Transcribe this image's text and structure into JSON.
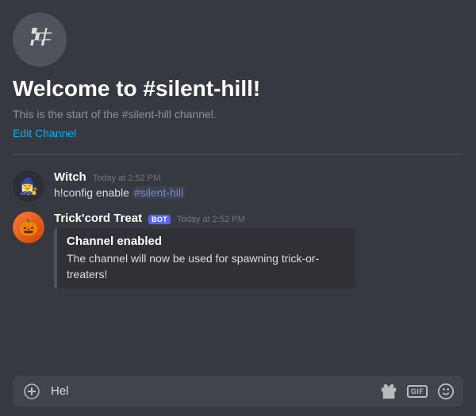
{
  "channel": {
    "icon": "#",
    "title": "Welcome to #silent-hill!",
    "description": "This is the start of the #silent-hill channel.",
    "edit_link": "Edit Channel"
  },
  "messages": [
    {
      "id": "msg1",
      "avatar_emoji": "🧙‍♀️",
      "avatar_type": "witch",
      "username": "Witch",
      "is_bot": false,
      "timestamp": "Today at 2:52 PM",
      "text": "h!config enable ",
      "mention": "#silent-hill",
      "embed": null
    },
    {
      "id": "msg2",
      "avatar_emoji": "🎃",
      "avatar_type": "bot",
      "username": "Trick'cord Treat",
      "is_bot": true,
      "bot_label": "BOT",
      "timestamp": "Today at 2:52 PM",
      "text": "",
      "mention": null,
      "embed": {
        "title": "Channel enabled",
        "description": "The channel will now be used for spawning trick-or-treaters!"
      }
    }
  ],
  "input": {
    "placeholder": "Hel",
    "add_icon": "+",
    "gift_icon": "🎁",
    "gif_label": "GIF",
    "emoji_icon": "😀"
  }
}
